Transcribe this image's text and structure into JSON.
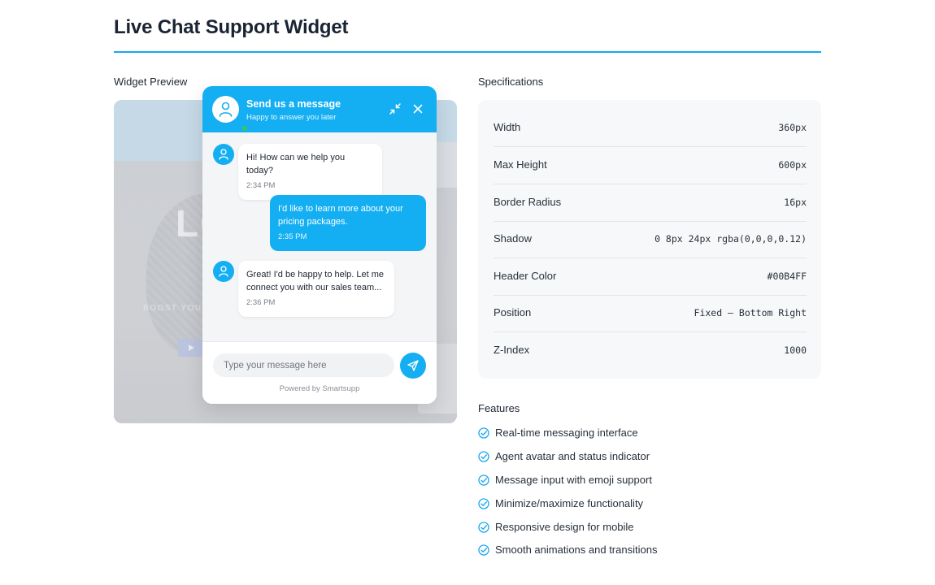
{
  "page": {
    "title": "Live Chat Support Widget",
    "accent_color": "#1AA7F0"
  },
  "preview": {
    "label": "Widget Preview",
    "background": {
      "headline_fragment": "LC",
      "tagline_fragment": "BOOST YOUR C"
    }
  },
  "widget": {
    "header": {
      "title": "Send us a message",
      "subtitle": "Happy to answer you later",
      "color": "#00B4FF",
      "icons": [
        "user-avatar-icon",
        "online-status-dot",
        "minimize-icon",
        "close-icon"
      ]
    },
    "messages": [
      {
        "sender": "agent",
        "text": "Hi! How can we help you today?",
        "time": "2:34 PM"
      },
      {
        "sender": "user",
        "text": "I'd like to learn more about your pricing packages.",
        "time": "2:35 PM"
      },
      {
        "sender": "agent",
        "text": "Great! I'd be happy to help. Let me connect you with our sales team...",
        "time": "2:36 PM"
      }
    ],
    "input": {
      "placeholder": "Type your message here",
      "value": ""
    },
    "send_icon": "send-icon",
    "powered_by": "Powered by Smartsupp"
  },
  "specifications": {
    "label": "Specifications",
    "rows": [
      {
        "key": "Width",
        "value": "360px"
      },
      {
        "key": "Max Height",
        "value": "600px"
      },
      {
        "key": "Border Radius",
        "value": "16px"
      },
      {
        "key": "Shadow",
        "value": "0 8px 24px rgba(0,0,0,0.12)"
      },
      {
        "key": "Header Color",
        "value": "#00B4FF"
      },
      {
        "key": "Position",
        "value": "Fixed — Bottom Right"
      },
      {
        "key": "Z-Index",
        "value": "1000"
      }
    ]
  },
  "features": {
    "label": "Features",
    "icon": "check-circle-icon",
    "items": [
      "Real-time messaging interface",
      "Agent avatar and status indicator",
      "Message input with emoji support",
      "Minimize/maximize functionality",
      "Responsive design for mobile",
      "Smooth animations and transitions"
    ]
  }
}
